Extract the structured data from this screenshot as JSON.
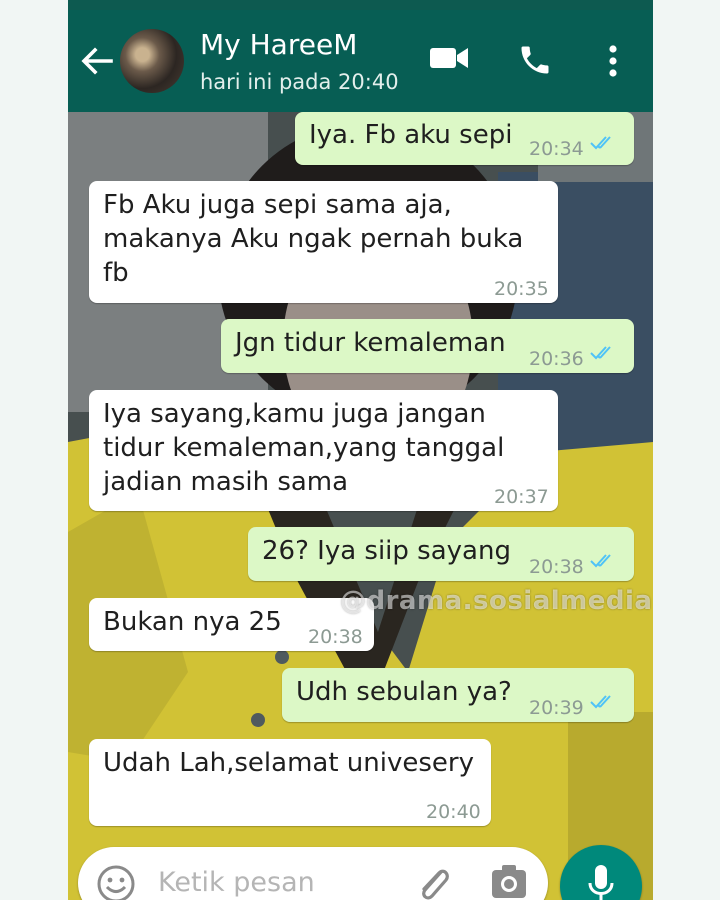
{
  "header": {
    "contact_name": "My HareeM",
    "last_seen": "hari ini pada 20:40"
  },
  "messages": [
    {
      "dir": "out",
      "text": "Iya. Fb aku sepi",
      "time": "20:34",
      "ticks": "read"
    },
    {
      "dir": "in",
      "text": "Fb Aku juga sepi sama aja,\nmakanya Aku ngak pernah buka\nfb",
      "time": "20:35"
    },
    {
      "dir": "out",
      "text": "Jgn tidur kemaleman",
      "time": "20:36",
      "ticks": "read"
    },
    {
      "dir": "in",
      "text": "Iya sayang,kamu juga jangan\ntidur kemaleman,yang tanggal\njadian masih sama",
      "time": "20:37"
    },
    {
      "dir": "out",
      "text": "26? Iya siip sayang",
      "time": "20:38",
      "ticks": "read"
    },
    {
      "dir": "in",
      "text": "Bukan nya 25",
      "time": "20:38"
    },
    {
      "dir": "out",
      "text": "Udh sebulan ya?",
      "time": "20:39",
      "ticks": "read"
    },
    {
      "dir": "in",
      "text": "Udah Lah,selamat univesery",
      "time": "20:40"
    }
  ],
  "watermark": "@drama.sosialmedia",
  "composer": {
    "placeholder": "Ketik pesan"
  },
  "icons": {
    "back": "back-arrow-icon",
    "video": "video-call-icon",
    "call": "phone-call-icon",
    "more": "more-vertical-icon",
    "emoji": "emoji-icon",
    "attach": "paperclip-icon",
    "camera": "camera-icon",
    "mic": "microphone-icon",
    "read_receipt": "double-check-icon"
  },
  "colors": {
    "appbar": "#075e54",
    "outgoing_bubble": "#dcf8c6",
    "incoming_bubble": "#ffffff",
    "read_tick": "#4fc3f7",
    "mic_button": "#00897b"
  }
}
